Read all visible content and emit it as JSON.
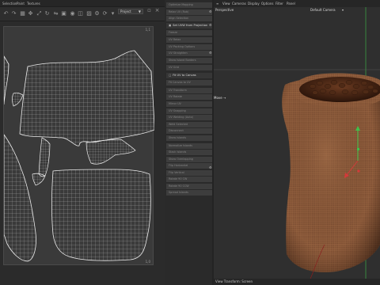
{
  "colors": {
    "uv_background": "#3a3a3a",
    "uv_wire": "#d8d8d8",
    "panel_bg": "#2a2a2a",
    "tool_item_bg": "#3d3d3d",
    "viewport_bg": "#2f2f2f",
    "sack_color": "#8a5a3a",
    "beans_color": "#3a1e10",
    "axis_green": "#3ec04a",
    "axis_red": "#d43a3a"
  },
  "uv_editor": {
    "menu": [
      "Selection",
      "Paint",
      "Textures"
    ],
    "toolbar_icons": [
      "undo-icon",
      "redo-icon",
      "grid-icon",
      "move-icon",
      "scale-icon",
      "rotate-icon",
      "mirror-icon",
      "lock-icon",
      "eye-icon",
      "layers-icon",
      "texture-icon",
      "settings-icon",
      "refresh-icon",
      "filter-icon"
    ],
    "projection_value": "Project",
    "corner_top_right": "1,1",
    "corner_bottom_right": "1,0"
  },
  "tools": {
    "items": [
      "Optimize Mapping",
      "Relax UV (Rub)",
      "Align Selection",
      "Set UVW from Projection",
      "Freeze",
      "UV Relax",
      "UV Packing Options",
      "UV Straighten",
      "Show Island Borders",
      "UV Grid",
      "Fit UV to Canvas",
      "Fit Canvas to UV",
      "UV Transform",
      "UV Rotate",
      "Mirror UV",
      "UV Snapping",
      "UV Welding (Auto)",
      "Weld Selected",
      "Disconnect",
      "Show Islands",
      "Normalize Islands",
      "Stack Islands",
      "Show Overlapping",
      "Flip Horizontal",
      "Flip Vertical",
      "Rotate 90 CW",
      "Rotate 90 CCW",
      "Spread Islands",
      "Align Horizontal",
      "Align Vertical",
      "Straighten UVs",
      "Rectangular",
      "Resample",
      "Terminal",
      "Quantize"
    ],
    "header_1": "Set UVW from Projection",
    "header_2": "Fit UV to Canvas"
  },
  "viewport": {
    "menu": [
      "View",
      "Cameras",
      "Display",
      "Options",
      "Filter",
      "Panel"
    ],
    "label": "Perspective",
    "camera": "Default Camera",
    "move_label": "Move",
    "status": "View Transform: Screen"
  }
}
